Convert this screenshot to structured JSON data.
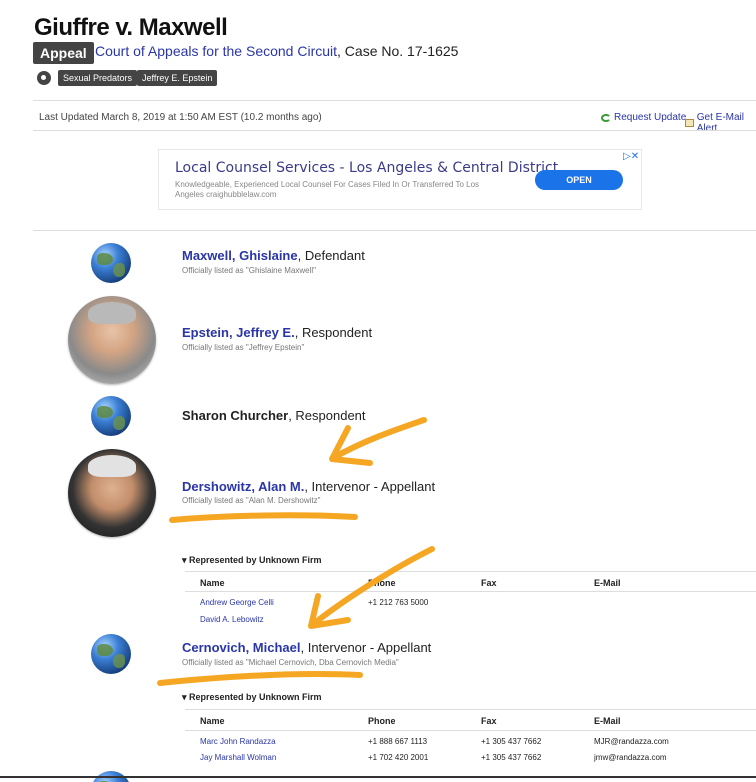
{
  "case": {
    "title": "Giuffre v. Maxwell",
    "badge": "Appeal",
    "court_link": "Court of Appeals for the Second Circuit",
    "case_number": ", Case No. 17-1625",
    "tags": [
      "Sexual Predators",
      "Jeffrey E. Epstein"
    ]
  },
  "header": {
    "last_updated": "Last Updated March 8, 2019 at 1:50 AM EST (10.2 months ago)",
    "request_update": "Request Update",
    "email_alert": "Get E-Mail Alert"
  },
  "ad": {
    "title": "Local Counsel Services - Los Angeles & Central District",
    "description": "Knowledgeable, Experienced Local Counsel For Cases Filed In Or Transferred To Los Angeles craighubblelaw.com",
    "button": "OPEN",
    "choice": "▷✕"
  },
  "parties": [
    {
      "name": "Maxwell, Ghislaine",
      "role": ", Defendant",
      "official": "Officially listed as \"Ghislaine Maxwell\""
    },
    {
      "name": "Epstein, Jeffrey E.",
      "role": ", Respondent",
      "official": "Officially listed as \"Jeffrey Epstein\""
    },
    {
      "name": "Sharon Churcher",
      "role": ", Respondent",
      "official": ""
    },
    {
      "name": "Dershowitz, Alan M.",
      "role": ", Intervenor - Appellant",
      "official": "Officially listed as \"Alan M. Dershowitz\""
    },
    {
      "name": "Cernovich, Michael",
      "role": ", Intervenor - Appellant",
      "official": "Officially listed as \"Michael Cernovich, Dba Cernovich Media\""
    }
  ],
  "representation": [
    {
      "heading": "▾ Represented by Unknown Firm",
      "columns": [
        "Name",
        "Phone",
        "Fax",
        "E-Mail"
      ],
      "rows": [
        {
          "name": "Andrew George Celli",
          "phone": "+1 212 763 5000",
          "fax": "",
          "email": ""
        },
        {
          "name": "David A. Lebowitz",
          "phone": "",
          "fax": "",
          "email": ""
        }
      ]
    },
    {
      "heading": "▾ Represented by Unknown Firm",
      "columns": [
        "Name",
        "Phone",
        "Fax",
        "E-Mail"
      ],
      "rows": [
        {
          "name": "Marc John Randazza",
          "phone": "+1 888 667 1113",
          "fax": "+1 305 437 7662",
          "email": "MJR@randazza.com"
        },
        {
          "name": "Jay Marshall Wolman",
          "phone": "+1 702 420 2001",
          "fax": "+1 305 437 7662",
          "email": "jmw@randazza.com"
        }
      ]
    }
  ],
  "colors": {
    "link": "#2a36a8",
    "annotation": "#f5a623",
    "badge": "#444444"
  }
}
